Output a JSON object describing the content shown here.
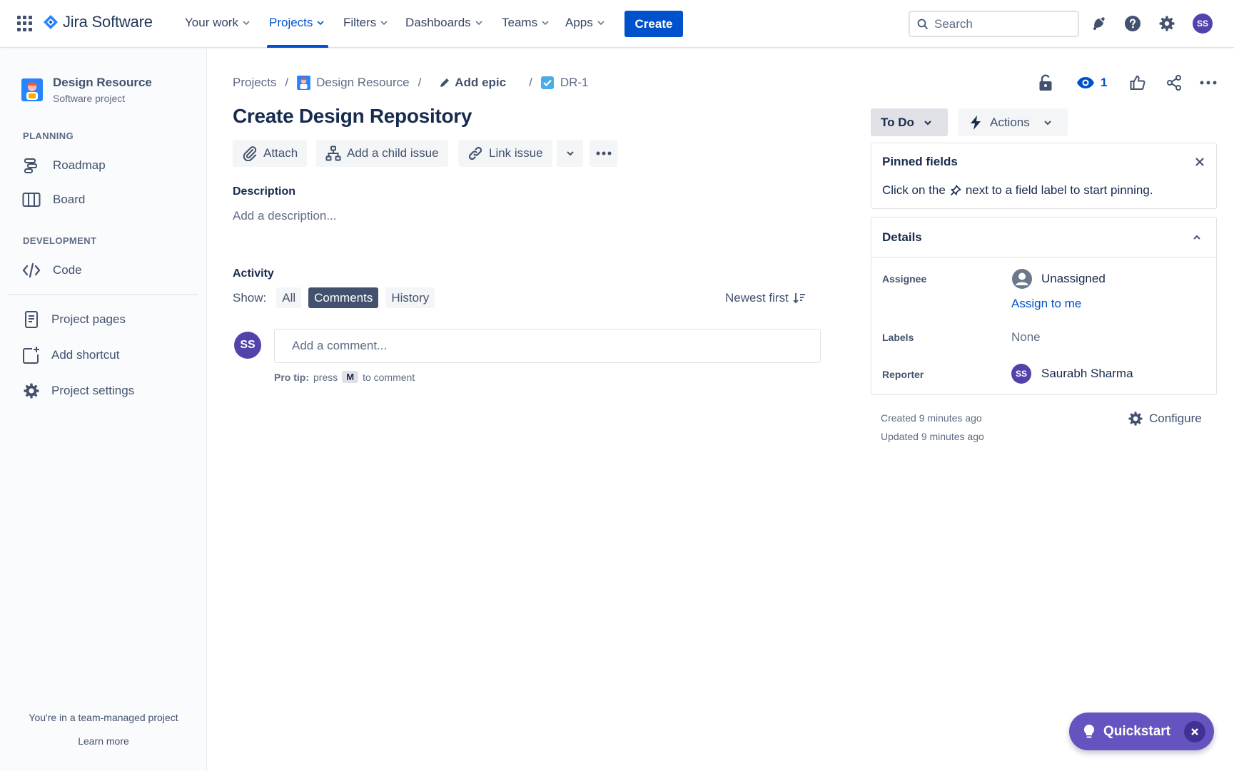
{
  "topnav": {
    "product_name": "Jira Software",
    "items": [
      {
        "label": "Your work"
      },
      {
        "label": "Projects"
      },
      {
        "label": "Filters"
      },
      {
        "label": "Dashboards"
      },
      {
        "label": "Teams"
      },
      {
        "label": "Apps"
      }
    ],
    "active_item": "Projects",
    "create_label": "Create",
    "search_placeholder": "Search",
    "user_initials": "SS"
  },
  "sidebar": {
    "project_name": "Design Resource",
    "project_type": "Software project",
    "planning_label": "PLANNING",
    "roadmap_label": "Roadmap",
    "board_label": "Board",
    "development_label": "DEVELOPMENT",
    "code_label": "Code",
    "project_pages_label": "Project pages",
    "add_shortcut_label": "Add shortcut",
    "project_settings_label": "Project settings",
    "team_managed_msg": "You're in a team-managed project",
    "learn_more_label": "Learn more"
  },
  "breadcrumb": {
    "projects": "Projects",
    "project": "Design Resource",
    "epic": "Add epic",
    "issue_key": "DR-1",
    "separator": "/"
  },
  "issue": {
    "title": "Create Design Repository",
    "toolbar": {
      "attach": "Attach",
      "add_child": "Add a child issue",
      "link_issue": "Link issue"
    },
    "description_heading": "Description",
    "description_placeholder": "Add a description...",
    "activity_heading": "Activity",
    "show_label": "Show:",
    "filters": {
      "all": "All",
      "comments": "Comments",
      "history": "History"
    },
    "selected_filter": "Comments",
    "sort_label": "Newest first",
    "comment_placeholder": "Add a comment...",
    "commenter_initials": "SS",
    "pro_tip_bold": "Pro tip:",
    "pro_tip_press": "press",
    "pro_tip_key": "M",
    "pro_tip_rest": "to comment"
  },
  "right": {
    "watch_count": "1",
    "status_label": "To Do",
    "actions_label": "Actions",
    "pinned_title": "Pinned fields",
    "pinned_text_before": "Click on the",
    "pinned_text_after": "next to a field label to start pinning.",
    "details_title": "Details",
    "assignee_label": "Assignee",
    "assignee_value": "Unassigned",
    "assign_to_me": "Assign to me",
    "labels_label": "Labels",
    "labels_value": "None",
    "reporter_label": "Reporter",
    "reporter_initials": "SS",
    "reporter_name": "Saurabh Sharma",
    "created": "Created 9 minutes ago",
    "updated": "Updated 9 minutes ago",
    "configure_label": "Configure"
  },
  "quickstart": {
    "label": "Quickstart"
  },
  "colors": {
    "primary": "#0052cc",
    "quickstart": "#6554c0",
    "avatar": "#5243aa"
  }
}
